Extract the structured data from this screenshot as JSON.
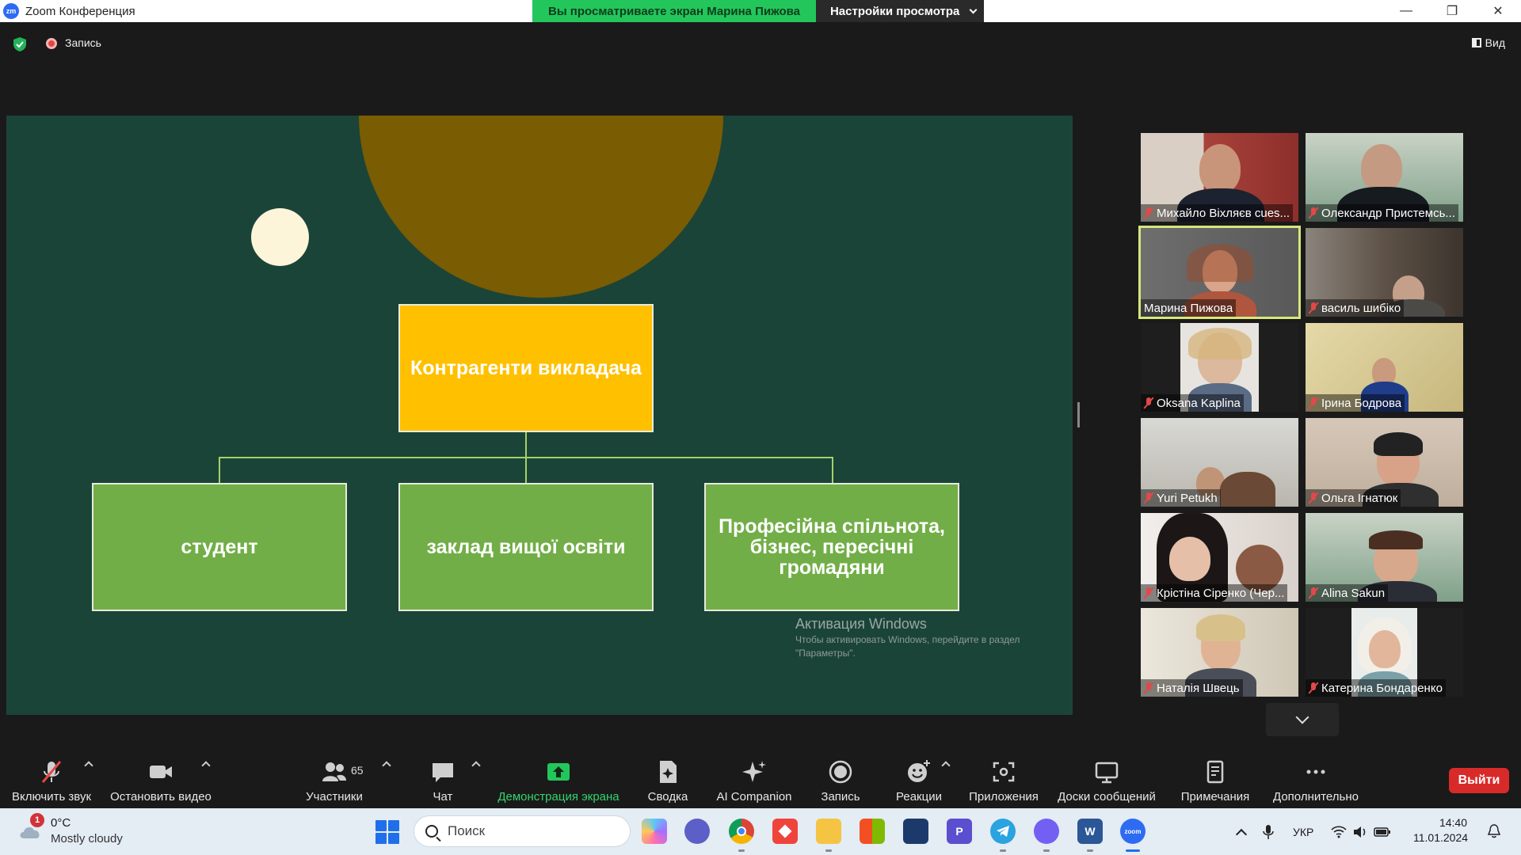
{
  "window": {
    "app_title": "Zoom Конференция",
    "logo_text": "zm",
    "controls": [
      "minimize",
      "restore",
      "close"
    ]
  },
  "share_banner": {
    "viewing_text": "Вы просматриваете экран Марина Пижова",
    "view_options_label": "Настройки просмотра"
  },
  "meeting_top": {
    "recording_label": "Запись",
    "view_label": "Вид"
  },
  "slide": {
    "top_box": "Контрагенти викладача",
    "boxes": [
      "студент",
      "заклад вищої освіти",
      "Професійна спільнота, бізнес, пересічні громадяни"
    ],
    "colors": {
      "background": "#1b4438",
      "top_box": "#ffc000",
      "green_box": "#72ae47"
    }
  },
  "watermark": {
    "title": "Активация Windows",
    "subtitle": "Чтобы активировать Windows, перейдите в раздел \"Параметры\"."
  },
  "participants": [
    {
      "name": "Михайло Віхляєв cues...",
      "muted": true
    },
    {
      "name": "Олександр Пристемсь...",
      "muted": true
    },
    {
      "name": "Марина Пижова",
      "muted": false,
      "active_speaker": true
    },
    {
      "name": "василь шибіко",
      "muted": true
    },
    {
      "name": "Oksana Kaplina",
      "muted": true
    },
    {
      "name": "Ірина Бодрова",
      "muted": true
    },
    {
      "name": "Yuri Petukh",
      "muted": true
    },
    {
      "name": "Ольга Ігнатюк",
      "muted": true
    },
    {
      "name": "Крістіна Сіренко (Чер...",
      "muted": true
    },
    {
      "name": "Alina Sakun",
      "muted": true
    },
    {
      "name": "Наталія Швець",
      "muted": true
    },
    {
      "name": "Катерина Бондаренко",
      "muted": true
    }
  ],
  "toolbar": {
    "unmute": "Включить звук",
    "stop_video": "Остановить видео",
    "participants": "Участники",
    "participants_count": "65",
    "chat": "Чат",
    "share_screen": "Демонстрация экрана",
    "summary": "Сводка",
    "ai_companion": "AI Companion",
    "record": "Запись",
    "reactions": "Реакции",
    "apps": "Приложения",
    "whiteboards": "Доски сообщений",
    "notes": "Примечания",
    "more": "Дополнительно",
    "leave": "Выйти",
    "accent_green": "#33d46b",
    "leave_color": "#d92a2a"
  },
  "taskbar": {
    "weather_badge": "1",
    "temperature": "0°C",
    "condition": "Mostly cloudy",
    "search_placeholder": "Поиск",
    "language": "УКР",
    "time": "14:40",
    "date": "11.01.2024",
    "apps": [
      "copilot-icon",
      "teams-chat-icon",
      "chrome-icon",
      "anydesk-icon",
      "file-explorer-icon",
      "microsoft-store-icon",
      "defender-icon",
      "p-app-icon",
      "telegram-icon",
      "viber-icon",
      "word-icon",
      "zoom-icon"
    ],
    "p_app_letter": "P",
    "word_letter": "W",
    "zoom_letter": "zoom"
  }
}
